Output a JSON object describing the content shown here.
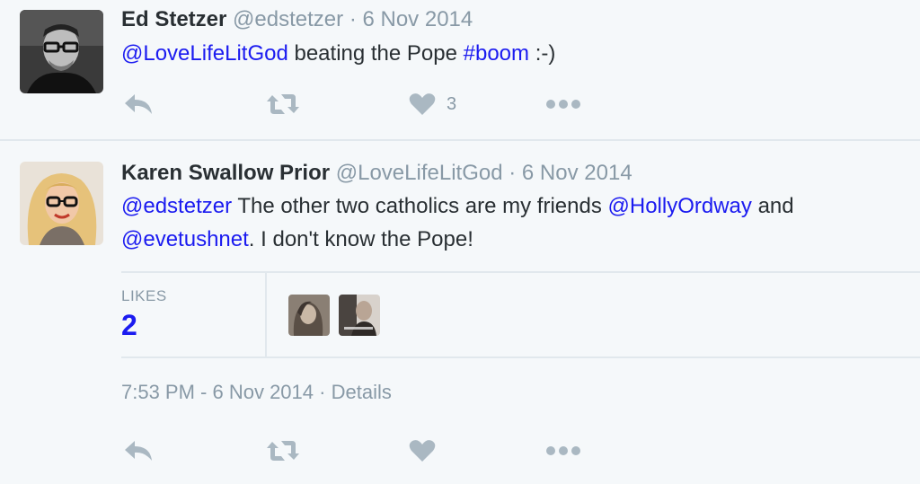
{
  "tweets": [
    {
      "name": "Ed Stetzer",
      "handle": "@edstetzer",
      "date": "6 Nov 2014",
      "text_parts": [
        {
          "text": "@LoveLifeLitGod",
          "type": "mention"
        },
        {
          "text": " beating the Pope ",
          "type": "plain"
        },
        {
          "text": "#boom",
          "type": "hashtag"
        },
        {
          "text": " :-)",
          "type": "plain"
        }
      ],
      "like_count": "3"
    },
    {
      "name": "Karen Swallow Prior",
      "handle": "@LoveLifeLitGod",
      "date": "6 Nov 2014",
      "text_parts": [
        {
          "text": "@edstetzer",
          "type": "mention"
        },
        {
          "text": " The other two catholics are my friends ",
          "type": "plain"
        },
        {
          "text": "@HollyOrdway",
          "type": "mention"
        },
        {
          "text": " and ",
          "type": "plain"
        },
        {
          "text": "@evetushnet",
          "type": "mention"
        },
        {
          "text": ".  I don't know the Pope!",
          "type": "plain"
        }
      ],
      "likes_label": "LIKES",
      "likes_count": "2",
      "timestamp": "7:53 PM - 6 Nov 2014",
      "details_label": "Details"
    }
  ],
  "separator": "·",
  "icons": [
    "reply-icon",
    "retweet-icon",
    "like-icon",
    "more-icon"
  ],
  "colors": {
    "link": "#1b1bf0",
    "muted": "#8899a6",
    "background": "#f5f8fa",
    "border": "#e1e8ed"
  }
}
